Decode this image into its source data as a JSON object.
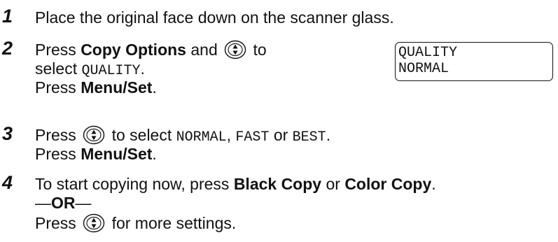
{
  "steps": [
    {
      "number": "1",
      "text": "Place the original face down on the scanner glass."
    },
    {
      "number": "2",
      "line1_pre": "Press ",
      "line1_bold": "Copy Options",
      "line1_mid": " and ",
      "line1_post": " to",
      "line2_pre": "select ",
      "line2_mono": "QUALITY",
      "line2_post": ".",
      "line3_pre": "Press ",
      "line3_bold": "Menu/Set",
      "line3_post": "."
    },
    {
      "number": "3",
      "line1_pre": "Press ",
      "line1_post": " to select ",
      "opt1": "NORMAL",
      "sep1": ", ",
      "opt2": "FAST",
      "sep2": " or ",
      "opt3": "BEST",
      "end": ".",
      "line2_pre": "Press ",
      "line2_bold": "Menu/Set",
      "line2_post": "."
    },
    {
      "number": "4",
      "line1_pre": "To start copying now, press ",
      "line1_bold1": "Black Copy",
      "line1_mid": " or ",
      "line1_bold2": "Color Copy",
      "line1_post": ".",
      "or_dash1": "—",
      "or_text": "OR",
      "or_dash2": "—",
      "line3_pre": "Press ",
      "line3_post": " for more settings."
    }
  ],
  "lcd": {
    "line1": "QUALITY",
    "line2": "NORMAL"
  },
  "icon": "up-down-navigation-key-icon"
}
